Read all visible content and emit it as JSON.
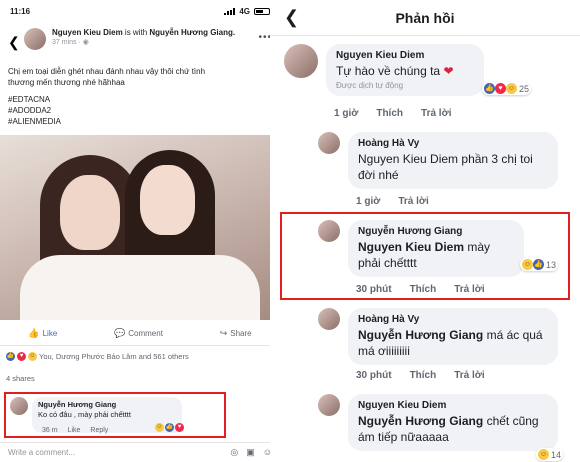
{
  "left": {
    "status": {
      "time": "11:16",
      "network": "4G"
    },
    "post": {
      "author": "Nguyen Kieu Diem",
      "with_text": "is with",
      "tagged": "Nguyễn Hương Giang.",
      "time": "37 mins",
      "body_lines": [
        "Chị em toại diễn ghét nhau đánh nhau vậy thôi chứ tình",
        "thương mến thương nhé hãhhaa",
        "",
        "#EDTACNA",
        "#ADODDA2",
        "#ALIENMEDIA"
      ]
    },
    "actions": {
      "like": "Like",
      "comment": "Comment",
      "share": "Share"
    },
    "reactions_text": "You, Dương Phước Bảo Lâm and 561 others",
    "shares_text": "4 shares",
    "comment": {
      "author": "Nguyễn Hương Giang",
      "text": "Ko có đâu , mày phải chếtttt",
      "time": "36 m",
      "like": "Like",
      "reply": "Reply"
    },
    "write_placeholder": "Write a comment...",
    "write_icons": [
      "camera-icon",
      "gif-icon",
      "emoji-icon"
    ]
  },
  "right": {
    "title": "Phản hồi",
    "comments": [
      {
        "author": "Nguyen Kieu Diem",
        "text": "Tự hào về chúng ta",
        "translate": "Được dịch tự động",
        "count": "25",
        "time": "1 giờ",
        "like": "Thích",
        "reply": "Trả lời"
      },
      {
        "author": "Hoàng Hà Vy",
        "mention": "Nguyen Kieu Diem",
        "text": " phần 3 chị toi đời nhé",
        "time": "1 giờ",
        "reply": "Trả lời"
      },
      {
        "author": "Nguyễn Hương Giang",
        "mention": "Nguyen Kieu Diem",
        "text": " mày phải chếtttt",
        "count": "13",
        "time": "30 phút",
        "like": "Thích",
        "reply": "Trả lời"
      },
      {
        "author": "Hoàng Hà Vy",
        "mention": "Nguyễn Hương Giang",
        "text": " má ác quá má ơiiiiiiiii",
        "time": "30 phút",
        "like": "Thích",
        "reply": "Trả lời"
      },
      {
        "author": "Nguyen Kieu Diem",
        "mention": "Nguyễn Hương Giang",
        "text": " chết cũng ám tiếp nữaaaaa",
        "count": "14"
      }
    ]
  },
  "colors": {
    "highlight": "#e02020",
    "fb_blue": "#4267b2",
    "bubble": "#f0f2f5"
  }
}
